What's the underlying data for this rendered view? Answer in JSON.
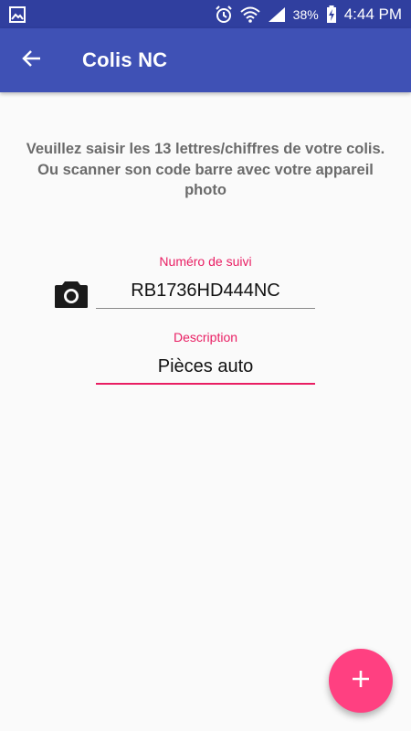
{
  "status_bar": {
    "left_icons": [
      "gallery-icon"
    ],
    "right_icons": [
      "alarm-icon",
      "wifi-icon",
      "signal-icon",
      "battery-charging-icon"
    ],
    "battery_percent": "38%",
    "time": "4:44 PM"
  },
  "app_bar": {
    "title": "Colis NC",
    "back_icon": "arrow-left-icon",
    "background": "#3f51b5",
    "status_background": "#303f9f"
  },
  "instructions": {
    "text": "Veuillez saisir les 13 lettres/chiffres de votre colis. Ou scanner son code barre avec votre appareil photo"
  },
  "form": {
    "tracking": {
      "label": "Numéro de suivi",
      "value": "RB1736HD444NC",
      "icon": "camera-icon"
    },
    "description": {
      "label": "Description",
      "value": "Pièces auto"
    }
  },
  "fab": {
    "icon": "plus-icon",
    "color": "#ff4081"
  },
  "colors": {
    "accent": "#e91e63",
    "text_secondary": "#6b6b6b",
    "background": "#fafafa"
  }
}
